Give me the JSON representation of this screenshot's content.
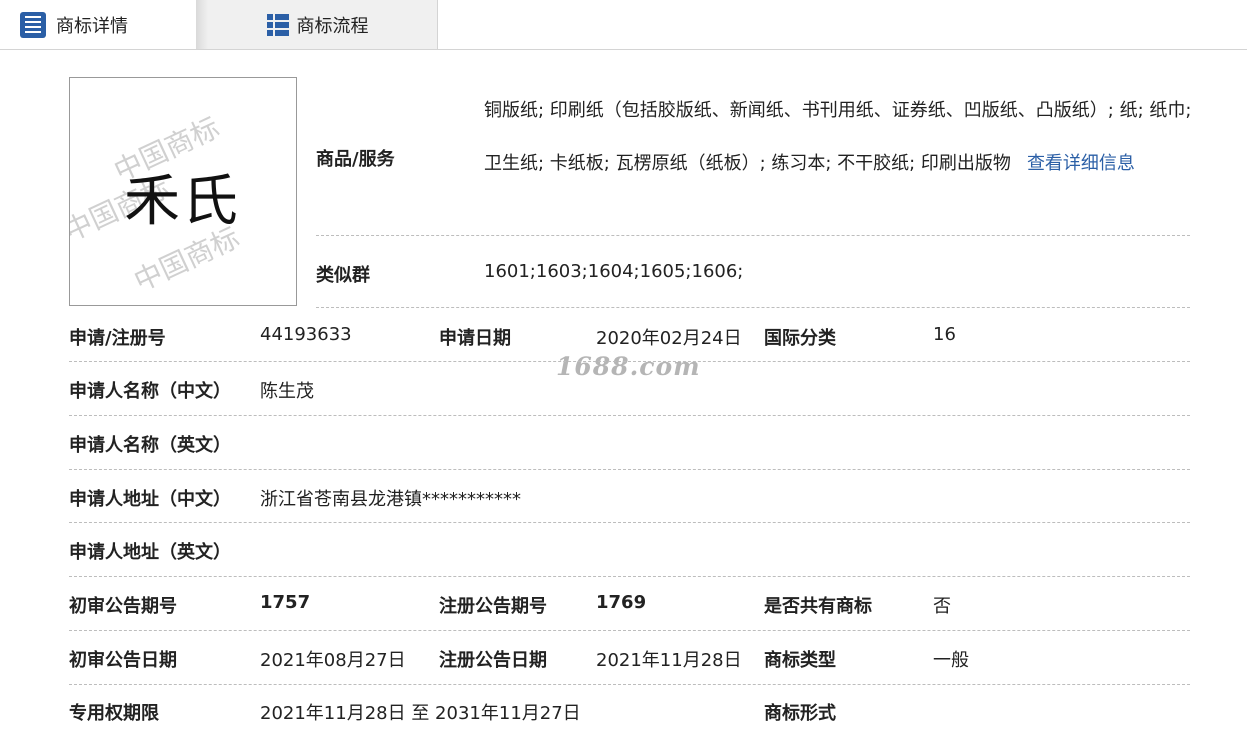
{
  "tabs": {
    "detail": "商标详情",
    "process": "商标流程"
  },
  "logo": {
    "text": "禾氏",
    "watermark": "中国商标"
  },
  "goods": {
    "label": "商品/服务",
    "text": "铜版纸; 印刷纸（包括胶版纸、新闻纸、书刊用纸、证券纸、凹版纸、凸版纸）; 纸; 纸巾; 卫生纸; 卡纸板; 瓦楞原纸（纸板）; 练习本; 不干胶纸; 印刷出版物",
    "more_link": "查看详细信息"
  },
  "similar": {
    "label": "类似群",
    "value": "1601;1603;1604;1605;1606;"
  },
  "reg_no": {
    "label": "申请/注册号",
    "value": "44193633"
  },
  "apply_date": {
    "label": "申请日期",
    "value": "2020年02月24日"
  },
  "intl_class": {
    "label": "国际分类",
    "value": "16"
  },
  "applicant_cn": {
    "label": "申请人名称（中文）",
    "value": "陈生茂"
  },
  "applicant_en": {
    "label": "申请人名称（英文）",
    "value": ""
  },
  "address_cn": {
    "label": "申请人地址（中文）",
    "value": "浙江省苍南县龙港镇***********"
  },
  "address_en": {
    "label": "申请人地址（英文）",
    "value": ""
  },
  "prelim_no": {
    "label": "初审公告期号",
    "value": "1757"
  },
  "reg_notice_no": {
    "label": "注册公告期号",
    "value": "1769"
  },
  "shared": {
    "label": "是否共有商标",
    "value": "否"
  },
  "prelim_date": {
    "label": "初审公告日期",
    "value": "2021年08月27日"
  },
  "reg_notice_date": {
    "label": "注册公告日期",
    "value": "2021年11月28日"
  },
  "tm_type": {
    "label": "商标类型",
    "value": "一般"
  },
  "term": {
    "label": "专用权期限",
    "value": "2021年11月28日 至 2031年11月27日"
  },
  "tm_form": {
    "label": "商标形式",
    "value": ""
  },
  "watermark_site": "1688.com"
}
